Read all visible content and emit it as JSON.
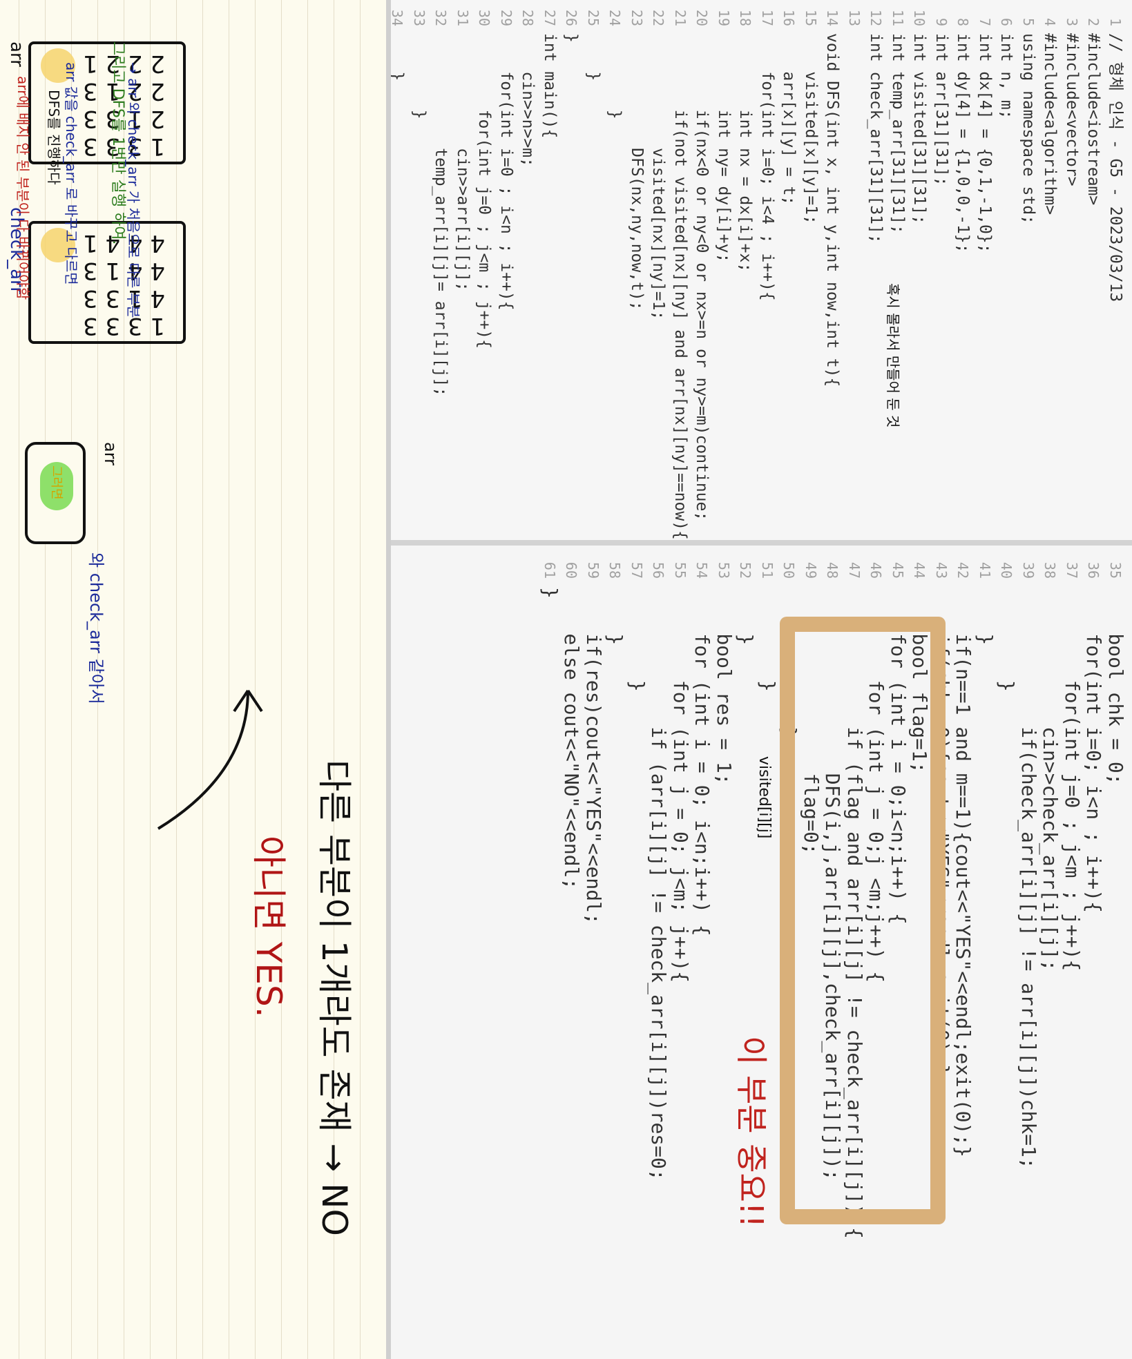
{
  "code_left": {
    "lines": [
      {
        "n": "1",
        "t": "// 형체 인식 - G5 - 2023/03/13"
      },
      {
        "n": "2",
        "t": "#include<iostream>"
      },
      {
        "n": "3",
        "t": "#include<vector>"
      },
      {
        "n": "4",
        "t": "#include<algorithm>"
      },
      {
        "n": "5",
        "t": "using namespace std;"
      },
      {
        "n": "6",
        "t": "int n, m;"
      },
      {
        "n": "7",
        "t": "int dx[4] = {0,1,-1,0};"
      },
      {
        "n": "8",
        "t": "int dy[4] = {1,0,0,-1};"
      },
      {
        "n": "9",
        "t": "int arr[31][31];"
      },
      {
        "n": "10",
        "t": "int visited[31][31];"
      },
      {
        "n": "11",
        "t": "int temp_arr[31][31];"
      },
      {
        "n": "12",
        "t": "int check_arr[31][31];"
      },
      {
        "n": "13",
        "t": ""
      },
      {
        "n": "14",
        "t": "void DFS(int x, int y,int now,int t){"
      },
      {
        "n": "15",
        "t": "    visited[x][y]=1;"
      },
      {
        "n": "16",
        "t": "    arr[x][y] = t;"
      },
      {
        "n": "17",
        "t": "    for(int i=0; i<4 ; i++){"
      },
      {
        "n": "18",
        "t": "        int nx = dx[i]+x;"
      },
      {
        "n": "19",
        "t": "        int ny= dy[i]+y;"
      },
      {
        "n": "20",
        "t": "        if(nx<0 or ny<0 or nx>=n or ny>=m)continue;"
      },
      {
        "n": "21",
        "t": "        if(not visited[nx][ny] and arr[nx][ny]==now){"
      },
      {
        "n": "22",
        "t": "            visited[nx][ny]=1;"
      },
      {
        "n": "23",
        "t": "            DFS(nx,ny,now,t);"
      },
      {
        "n": "24",
        "t": "        }"
      },
      {
        "n": "25",
        "t": "    }"
      },
      {
        "n": "26",
        "t": "}"
      },
      {
        "n": "27",
        "t": "int main(){"
      },
      {
        "n": "28",
        "t": "    cin>>n>>m;"
      },
      {
        "n": "29",
        "t": "    for(int i=0 ; i<n ; i++){"
      },
      {
        "n": "30",
        "t": "        for(int j=0 ; j<m ; j++){"
      },
      {
        "n": "31",
        "t": "            cin>>arr[i][j];"
      },
      {
        "n": "32",
        "t": "            temp_arr[i][j]= arr[i][j];"
      },
      {
        "n": "33",
        "t": "        }"
      },
      {
        "n": "34",
        "t": "    }"
      }
    ]
  },
  "code_right": {
    "lines": [
      {
        "n": "35",
        "t": "    bool chk = 0;"
      },
      {
        "n": "36",
        "t": "    for(int i=0; i<n ; i++){"
      },
      {
        "n": "37",
        "t": "        for(int j=0 ; j<m ; j++){"
      },
      {
        "n": "38",
        "t": "            cin>>check_arr[i][j];"
      },
      {
        "n": "39",
        "t": "            if(check_arr[i][j] != arr[i][j])chk=1;"
      },
      {
        "n": "40",
        "t": "        }"
      },
      {
        "n": "41",
        "t": "    }"
      },
      {
        "n": "42",
        "t": "    if(n==1 and m==1){cout<<\"YES\"<<endl;exit(0);}"
      },
      {
        "n": "43",
        "t": "    if(chk==0){cout<<\"YES\"<<endl;exit(0);}"
      },
      {
        "n": "44",
        "t": "    bool flag=1;"
      },
      {
        "n": "45",
        "t": "    for (int i = 0;i<n;i++) {"
      },
      {
        "n": "46",
        "t": "        for (int j = 0;j <m;j++) {"
      },
      {
        "n": "47",
        "t": "            if (flag and arr[i][j] != check_arr[i][j]) {"
      },
      {
        "n": "48",
        "t": "                DFS(i,j,arr[i][j],check_arr[i][j]);"
      },
      {
        "n": "49",
        "t": "                flag=0;"
      },
      {
        "n": "50",
        "t": "            }"
      },
      {
        "n": "51",
        "t": "        }"
      },
      {
        "n": "52",
        "t": "    }"
      },
      {
        "n": "53",
        "t": "    bool res = 1;"
      },
      {
        "n": "54",
        "t": "    for (int i = 0; i<n;i++) {"
      },
      {
        "n": "55",
        "t": "        for (int j = 0; j<m; j++){"
      },
      {
        "n": "56",
        "t": "            if (arr[i][j] != check_arr[i][j])res=0;"
      },
      {
        "n": "57",
        "t": "        }"
      },
      {
        "n": "58",
        "t": "    }"
      },
      {
        "n": "59",
        "t": "    if(res)cout<<\"YES\"<<endl;"
      },
      {
        "n": "60",
        "t": "    else cout<<\"NO\"<<endl;"
      },
      {
        "n": "61",
        "t": "}"
      }
    ]
  },
  "annotations": {
    "temp_note": "혹시 몰라서 만들어 둔 것",
    "visited_note": "visited[i][j]",
    "only_one": "이 부분 중요!!",
    "no_result": "다른 부분이 1개라도 존재 → NO",
    "yes_result": "아니면 YES.",
    "arr_label": "arr",
    "check_label": "check_arr",
    "arr_rows": [
      "2 2 2 1",
      "2 2 1 3",
      "2 1 3 3",
      "1 3 3 3"
    ],
    "check_rows": [
      "4 4 4 1",
      "4 4 1 3",
      "4 1 3 3",
      "1 3 3 3"
    ],
    "legend_arrow": "→ arr 와 check_arr 가 처음으로 다른 부분",
    "dfs_note": "그리고 DFS를 1번만 실행 하여.",
    "dfs_sub1": "arr 값을 check_arr 로 바꾸고 다르면",
    "dfs_sub2": "DFS를 진행하다",
    "dfs_sub3": "arr에 배지 안 된 부분이 다 바뀌어야함",
    "region_label": "arr",
    "region_text": "그러면",
    "compare": "와 check_arr 같아서"
  }
}
